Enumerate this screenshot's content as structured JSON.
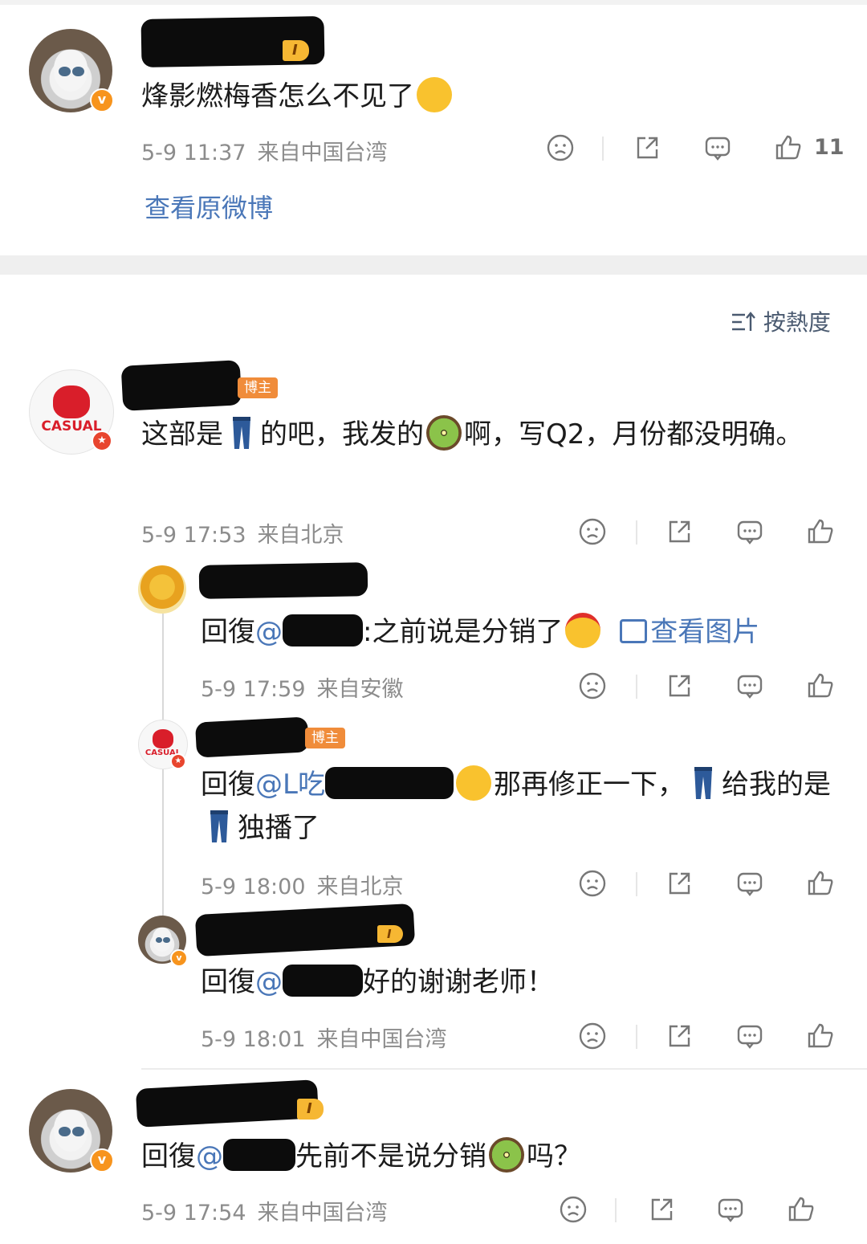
{
  "top_post": {
    "user_level": "I",
    "content": "烽影燃梅香怎么不见了",
    "time": "5-9 11:37",
    "location": "来自中国台湾",
    "like_count": "11",
    "view_original": "查看原微博"
  },
  "sort_label": "按熱度",
  "comments": [
    {
      "author_badge": "博主",
      "avatar_text": "CASUAL",
      "content_a": "这部是",
      "content_b": "的吧，我发的",
      "content_c": "啊，写Q2，月份都没明确。",
      "time": "5-9 17:53",
      "location": "来自北京"
    },
    {
      "reply_prefix": "回復",
      "mention": "@",
      "content": ":之前说是分销了",
      "view_image": "查看图片",
      "time": "5-9 17:59",
      "location": "来自安徽"
    },
    {
      "author_badge": "博主",
      "avatar_text": "CASUAL",
      "reply_prefix": "回復",
      "mention": "@L吃",
      "content_a": "那再修正一下，",
      "content_b": "给我的是",
      "content_c": "独播了",
      "time": "5-9 18:00",
      "location": "来自北京"
    },
    {
      "user_level": "I",
      "reply_prefix": "回復",
      "mention": "@",
      "content": "好的谢谢老师！",
      "time": "5-9 18:01",
      "location": "来自中国台湾"
    },
    {
      "user_level": "I",
      "reply_prefix": "回復",
      "mention": "@",
      "content_a": "先前不是说分销",
      "content_b": "吗？",
      "time": "5-9 17:54",
      "location": "来自中国台湾"
    }
  ],
  "colors": {
    "link": "#4a77b8",
    "meta": "#8c8c8c",
    "badge_orange": "#f7941d",
    "level_gold": "#f6b733"
  },
  "icons": [
    "dislike-face-icon",
    "share-icon",
    "comment-icon",
    "thumbs-up-icon",
    "sort-icon",
    "image-icon",
    "jeans-icon",
    "kiwi-emoji"
  ]
}
